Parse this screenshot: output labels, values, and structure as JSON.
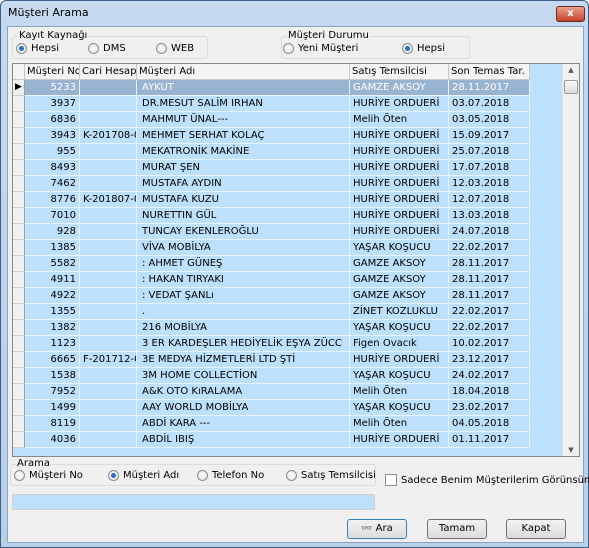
{
  "window": {
    "title": "Müşteri Arama",
    "close_label": "x"
  },
  "kayit_kaynagi": {
    "label": "Kayıt Kaynağı",
    "options": [
      {
        "label": "Hepsi",
        "selected": true
      },
      {
        "label": "DMS",
        "selected": false
      },
      {
        "label": "WEB",
        "selected": false
      }
    ]
  },
  "musteri_durumu": {
    "label": "Müşteri Durumu",
    "options": [
      {
        "label": "Yeni Müşteri",
        "selected": false
      },
      {
        "label": "Hepsi",
        "selected": true
      }
    ]
  },
  "grid": {
    "columns": [
      "Müşteri No",
      "Cari Hesap",
      "Müşteri Adı",
      "Satış Temsilcisi",
      "Son Temas Tar."
    ],
    "selected_row": 0,
    "rows": [
      [
        "5233",
        "",
        "AYKUT",
        "GAMZE AKSOY",
        "28.11.2017"
      ],
      [
        "3937",
        "",
        "DR.MESUT SALİM IRHAN",
        "HURİYE ORDUERİ",
        "03.07.2018"
      ],
      [
        "6836",
        "",
        "MAHMUT ÜNAL---",
        "Melih Öten",
        "03.05.2018"
      ],
      [
        "3943",
        "K-201708-0",
        "MEHMET SERHAT KOLAÇ",
        "HURİYE ORDUERİ",
        "15.09.2017"
      ],
      [
        "955",
        "",
        "MEKATRONİK MAKİNE",
        "HURİYE ORDUERİ",
        "25.07.2018"
      ],
      [
        "8493",
        "",
        "MURAT ŞEN",
        "HURİYE ORDUERİ",
        "17.07.2018"
      ],
      [
        "7462",
        "",
        "MUSTAFA AYDIN",
        "HURİYE ORDUERİ",
        "12.03.2018"
      ],
      [
        "8776",
        "K-201807-0",
        "MUSTAFA KUZU",
        "HURİYE ORDUERİ",
        "12.07.2018"
      ],
      [
        "7010",
        "",
        "NURETTIN GÜL",
        "HURİYE ORDUERİ",
        "13.03.2018"
      ],
      [
        "928",
        "",
        "TUNCAY EKENLEROĞLU",
        "HURİYE ORDUERİ",
        "24.07.2018"
      ],
      [
        "1385",
        "",
        "VİVA MOBİLYA",
        "YAŞAR KOŞUCU",
        "22.02.2017"
      ],
      [
        "5582",
        "",
        ": AHMET GÜNEŞ",
        "GAMZE AKSOY",
        "28.11.2017"
      ],
      [
        "4911",
        "",
        ": HAKAN TIRYAKI",
        "GAMZE AKSOY",
        "28.11.2017"
      ],
      [
        "4922",
        "",
        ": VEDAT ŞANLı",
        "GAMZE AKSOY",
        "28.11.2017"
      ],
      [
        "1355",
        "",
        ".",
        "ZİNET KOZLUKLU",
        "22.02.2017"
      ],
      [
        "1382",
        "",
        "216 MOBİLYA",
        "YAŞAR KOŞUCU",
        "22.02.2017"
      ],
      [
        "1123",
        "",
        "3 ER KARDEŞLER HEDİYELİK EŞYA ZÜCC",
        "Figen Ovacık",
        "10.02.2017"
      ],
      [
        "6665",
        "F-201712-0",
        "3E MEDYA HİZMETLERİ LTD ŞTİ",
        "HURİYE ORDUERİ",
        "23.12.2017"
      ],
      [
        "1538",
        "",
        "3M HOME COLLECTİON",
        "YAŞAR KOŞUCU",
        "24.02.2017"
      ],
      [
        "7952",
        "",
        "A&K OTO KıRALAMA",
        "Melih Öten",
        "18.04.2018"
      ],
      [
        "1499",
        "",
        "AAY WORLD MOBİLYA",
        "YAŞAR KOŞUCU",
        "23.02.2017"
      ],
      [
        "8119",
        "",
        "ABDİ KARA ---",
        "Melih Öten",
        "04.05.2018"
      ],
      [
        "4036",
        "",
        "ABDİL IBIŞ",
        "HURİYE ORDUERİ",
        "01.11.2017"
      ]
    ]
  },
  "arama": {
    "label": "Arama",
    "options": [
      {
        "label": "Müşteri  No",
        "selected": false
      },
      {
        "label": "Müşteri Adı",
        "selected": true
      },
      {
        "label": "Telefon No",
        "selected": false
      },
      {
        "label": "Satış Temsilcisi",
        "selected": false
      }
    ]
  },
  "only_mine": {
    "label": "Sadece Benim Müşterilerim Görünsün",
    "checked": false
  },
  "search_value": "",
  "buttons": {
    "search": "Ara",
    "ok": "Tamam",
    "close": "Kapat"
  }
}
